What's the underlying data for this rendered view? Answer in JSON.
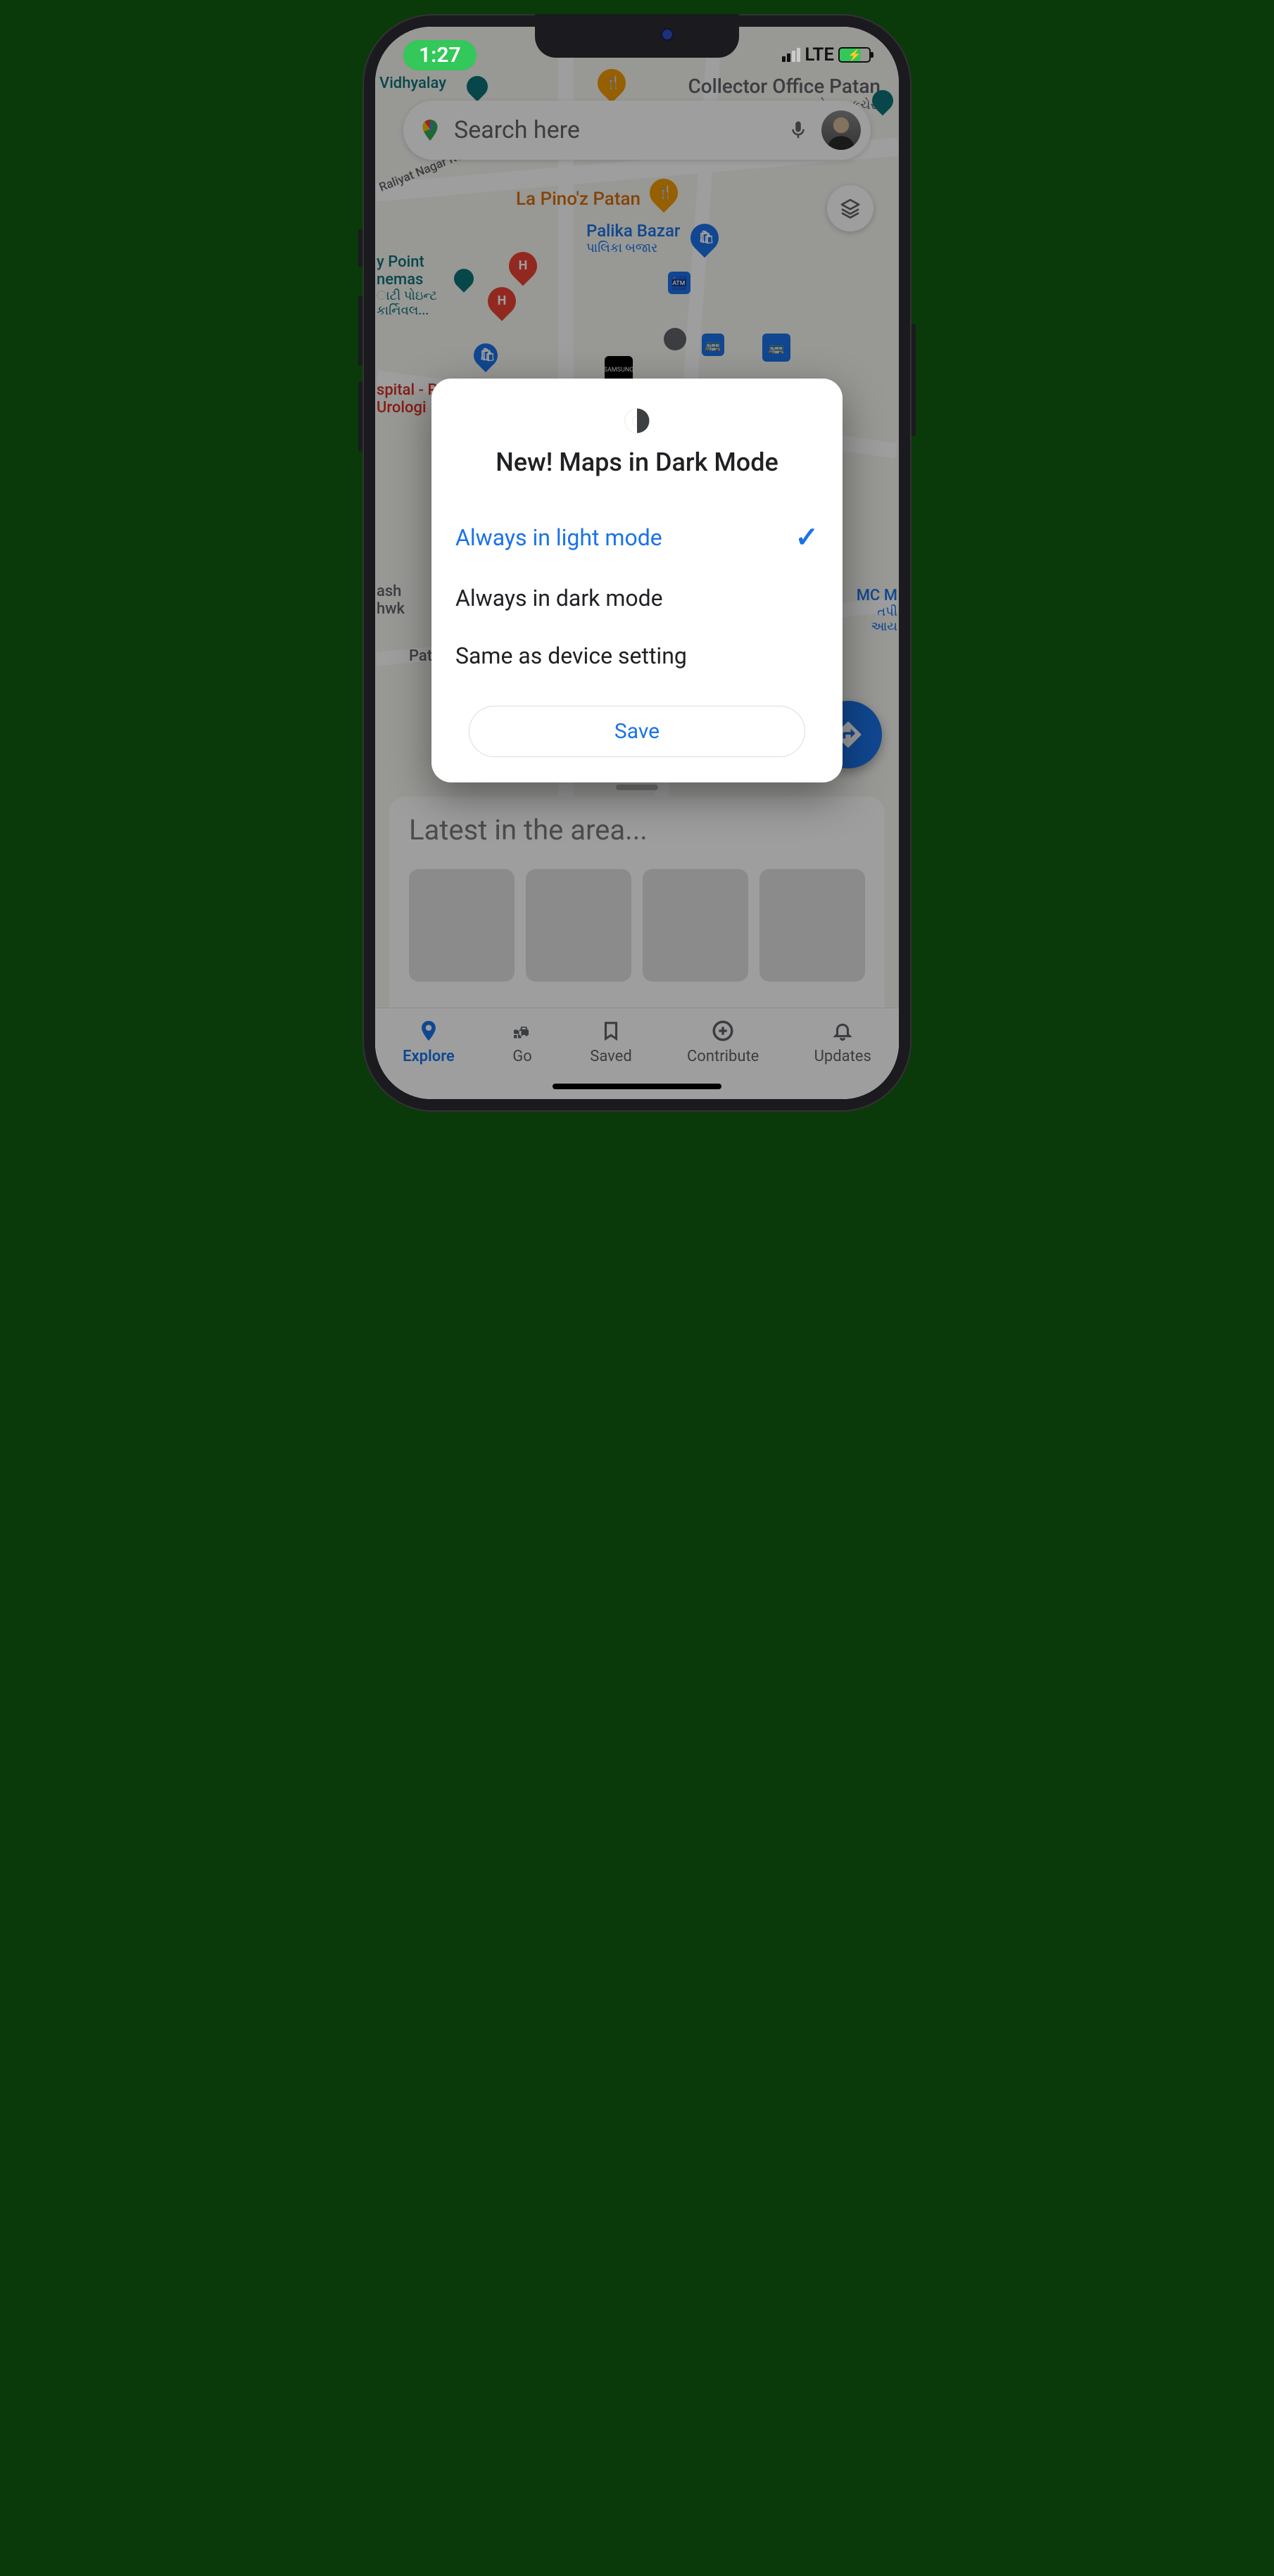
{
  "status": {
    "time": "1:27",
    "network": "LTE"
  },
  "search": {
    "placeholder": "Search here"
  },
  "map_labels": {
    "vidhyalay": "Vidhyalay",
    "collector": "Collector Office Patan",
    "collector_sub": "કલેક્ટર કચેરી",
    "raliyat": "Raliyat Nagar Rd",
    "lapino": "La Pino'z Patan",
    "palika": "Palika Bazar",
    "palika_sub": "પાલિકા બજાર",
    "point": "y Point",
    "cinemas": "nemas",
    "point_sub1": "ાટી પોઇન્ટ",
    "point_sub2": "કાર્નિવલ...",
    "hospital": "spital - P",
    "urolog": "Urologi",
    "ash": "ash",
    "hwk": "hwk",
    "patan": "Pata",
    "mc": "MC M",
    "mc_sub": "તપી",
    "mc_sub2": "આય"
  },
  "bottom_sheet": {
    "title": "Latest in the area..."
  },
  "nav": {
    "explore": "Explore",
    "go": "Go",
    "saved": "Saved",
    "contribute": "Contribute",
    "updates": "Updates"
  },
  "modal": {
    "title": "New! Maps in Dark Mode",
    "opt1": "Always in light mode",
    "opt2": "Always in dark mode",
    "opt3": "Same as device setting",
    "save": "Save"
  }
}
